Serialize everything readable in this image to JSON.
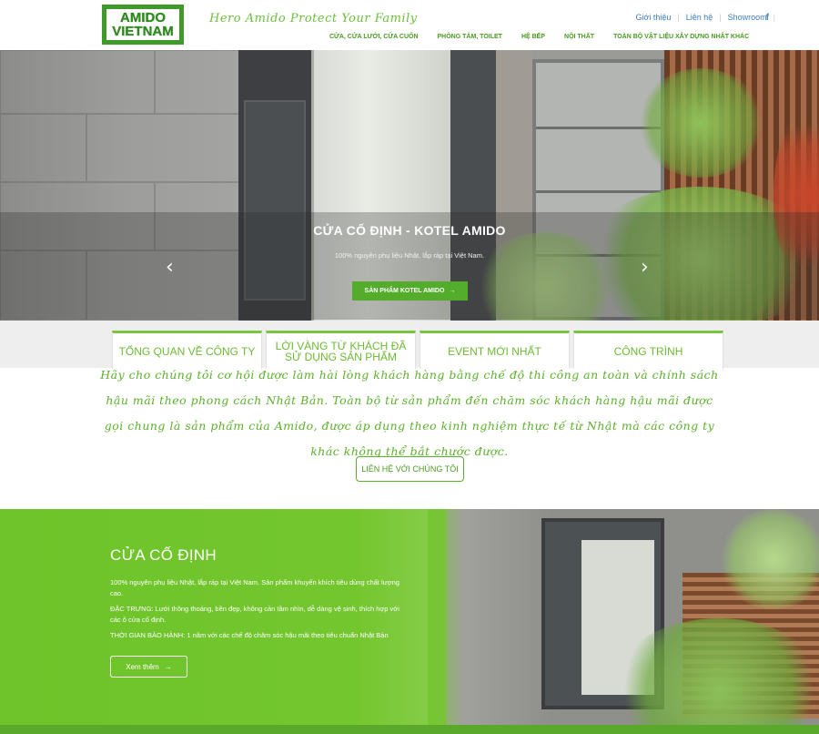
{
  "header": {
    "logo_line1": "AMIDO",
    "logo_line2": "VIETNAM",
    "tagline": "Hero Amido Protect Your Family",
    "toplinks": [
      "Giới thiệu",
      "Liên hệ",
      "Showroom"
    ],
    "facebook_icon": "facebook-icon",
    "nav": [
      "CỬA, CỬA LƯỚI, CỬA CUỐN",
      "PHÒNG TẮM, TOILET",
      "HỆ BẾP",
      "NỘI THẤT",
      "TOÀN BỘ VẬT LIỆU XÂY DỰNG NHẬT KHÁC"
    ]
  },
  "slider": {
    "title": "CỬA CỐ ĐỊNH - KOTEL AMIDO",
    "subtitle": "100% nguyên phụ liệu Nhật, lắp ráp tại Việt Nam.",
    "button_label": "SẢN PHẨM KOTEL AMIDO",
    "prev_arrow": "‹",
    "next_arrow": "›"
  },
  "tabs": [
    "TỔNG QUAN VỀ CÔNG TY",
    "LỜI VÀNG TỪ KHÁCH ĐÃ SỬ DỤNG SẢN PHẨM",
    "EVENT MỚI NHẤT",
    "CÔNG TRÌNH"
  ],
  "quote": {
    "text": "Hãy cho chúng tôi cơ hội được làm hài lòng khách hàng bằng chế độ thi công an toàn và chính sách hậu mãi theo phong cách Nhật Bản. Toàn bộ từ sản phẩm đến chăm sóc khách hàng hậu mãi được gọi chung là sản phẩm của Amido, được áp dụng theo kinh nghiệm thực tế từ Nhật mà các công ty khác không thể bắt chước được."
  },
  "contact_button": "LIÊN HỆ VỚI CHÚNG TÔI",
  "product": {
    "title": "CỬA CỐ ĐỊNH",
    "p1": "100% nguyên phụ liệu Nhật, lắp ráp tại Việt Nam. Sản phẩm khuyến khích tiêu dùng chất lượng cao.",
    "p2": "ĐẶC TRƯNG: Lưới thông thoáng, bền đẹp, không cản tầm nhìn, dễ dàng vệ sinh, thích hợp với các ô cửa cố định.",
    "p3": "THỜI GIAN BẢO HÀNH: 1 năm với các chế độ chăm sóc hậu mãi theo tiêu chuẩn Nhật Bản",
    "button_label": "Xem thêm"
  },
  "colors": {
    "brand_green": "#5bb02b",
    "panel_green": "#74c62e",
    "link_blue": "#3f7fc0"
  }
}
